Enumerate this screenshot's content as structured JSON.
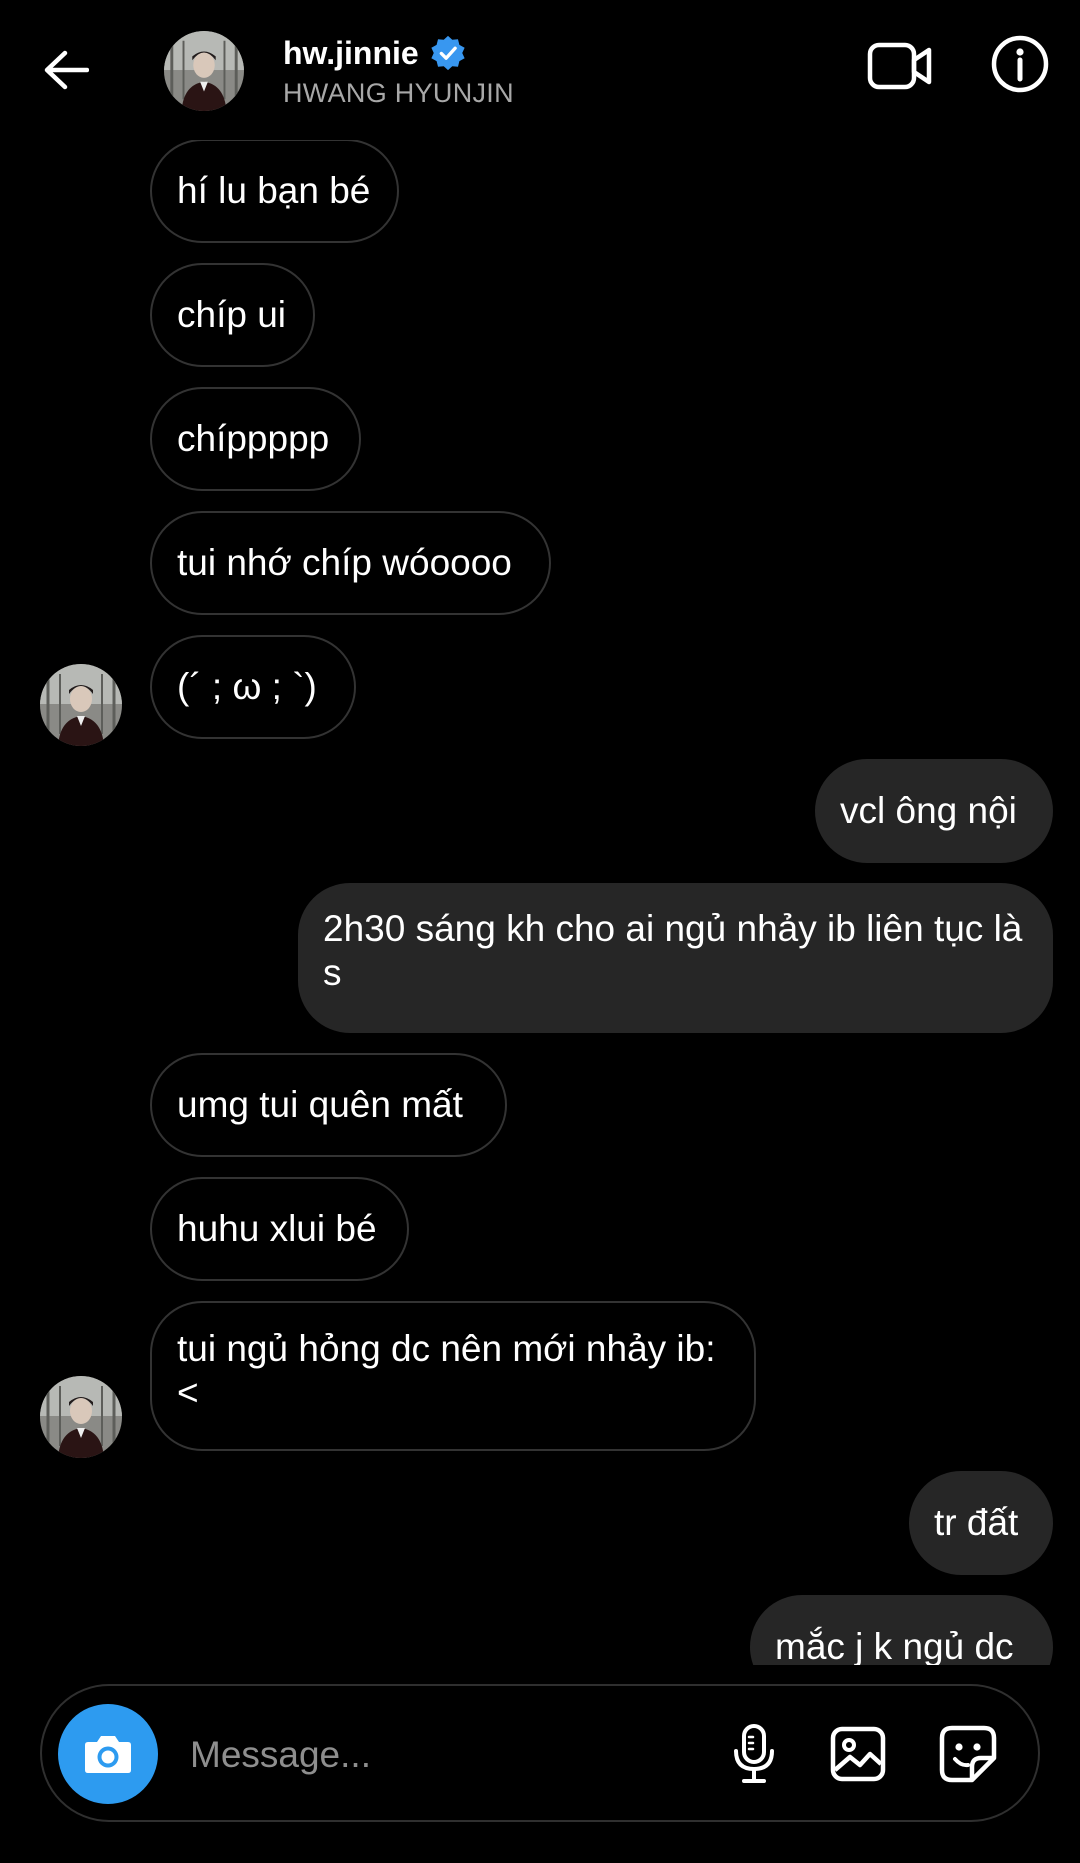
{
  "header": {
    "username": "hw.jinnie",
    "display_name": "HWANG HYUNJIN",
    "avatar": "profile-photo",
    "verified": true,
    "icons": {
      "back": "back-arrow-icon",
      "video": "video-call-icon",
      "info": "info-icon",
      "verified": "verified-badge-icon"
    }
  },
  "messages": [
    {
      "direction": "in",
      "text": "hí lu bạn bé"
    },
    {
      "direction": "in",
      "text": "chíp ui"
    },
    {
      "direction": "in",
      "text": "chíppppp"
    },
    {
      "direction": "in",
      "text": "tui nhớ chíp wóoooo"
    },
    {
      "direction": "in",
      "text": "(´ ; ω ; `)"
    },
    {
      "direction": "out",
      "text": "vcl ông nội"
    },
    {
      "direction": "out",
      "text": "2h30 sáng kh cho ai ngủ nhảy ib liên tục là s"
    },
    {
      "direction": "in",
      "text": "umg tui quên mất"
    },
    {
      "direction": "in",
      "text": "huhu xlui bé"
    },
    {
      "direction": "in",
      "text": "tui ngủ hỏng dc nên mới nhảy ib:<"
    },
    {
      "direction": "out",
      "text": "tr đất"
    },
    {
      "direction": "out",
      "text": "mắc j k ngủ dc"
    }
  ],
  "composer": {
    "placeholder": "Message...",
    "value": "",
    "icons": [
      "camera-icon",
      "microphone-icon",
      "gallery-icon",
      "sticker-icon"
    ]
  },
  "colors": {
    "background": "#000000",
    "outgoing_bubble": "#262626",
    "incoming_border": "#333333",
    "accent_blue": "#2d9bf0",
    "verified_blue": "#3897f0",
    "secondary_text": "#a8a8a8"
  }
}
